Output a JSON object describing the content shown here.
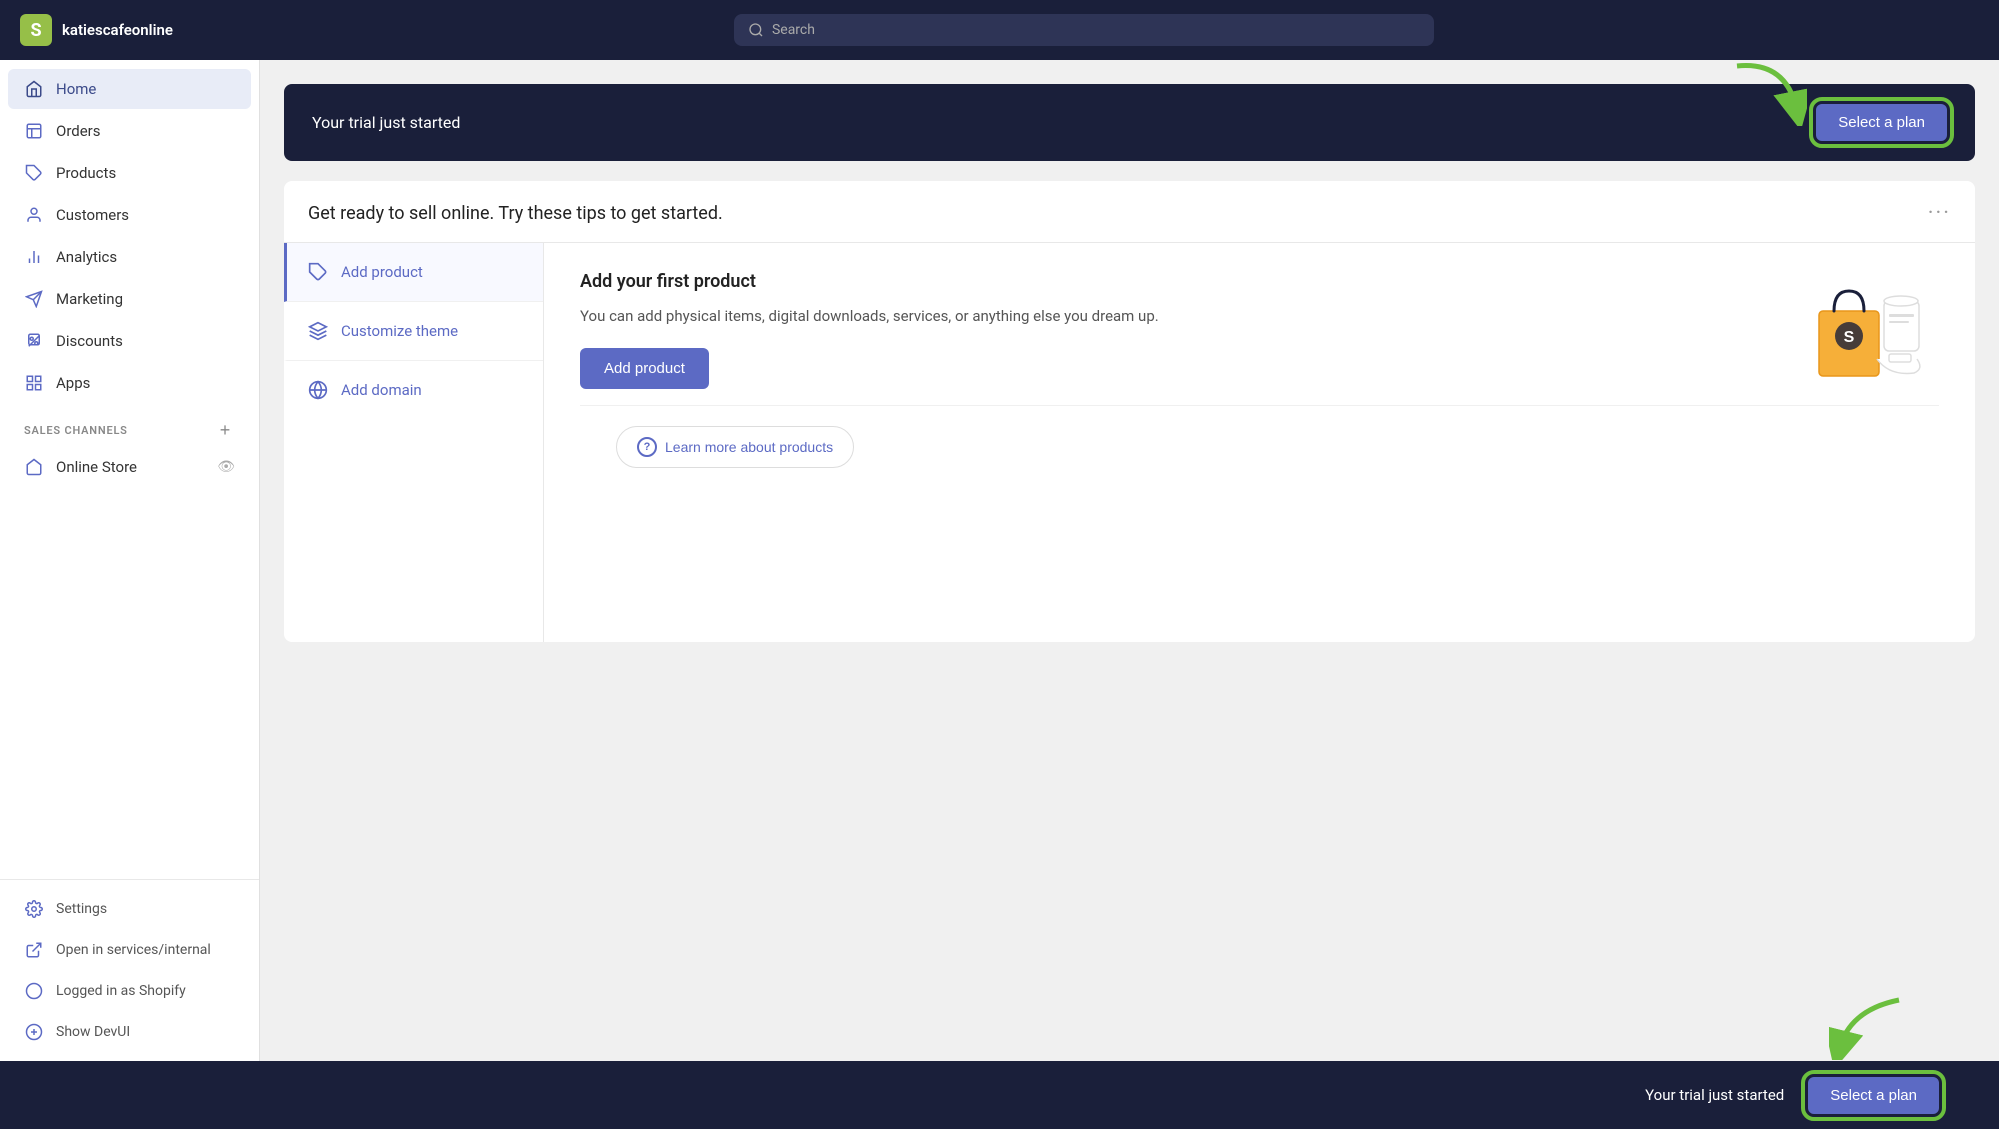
{
  "brand": {
    "name": "katiescafeonline",
    "icon_label": "S"
  },
  "search": {
    "placeholder": "Search"
  },
  "nav": {
    "items": [
      {
        "id": "home",
        "label": "Home",
        "icon": "house",
        "active": true
      },
      {
        "id": "orders",
        "label": "Orders",
        "icon": "receipt"
      },
      {
        "id": "products",
        "label": "Products",
        "icon": "tag"
      },
      {
        "id": "customers",
        "label": "Customers",
        "icon": "person"
      },
      {
        "id": "analytics",
        "label": "Analytics",
        "icon": "bar-chart"
      },
      {
        "id": "marketing",
        "label": "Marketing",
        "icon": "megaphone"
      },
      {
        "id": "discounts",
        "label": "Discounts",
        "icon": "discount"
      },
      {
        "id": "apps",
        "label": "Apps",
        "icon": "grid"
      }
    ],
    "sales_channels_label": "SALES CHANNELS",
    "sales_channels": [
      {
        "id": "online-store",
        "label": "Online Store"
      }
    ],
    "bottom_items": [
      {
        "id": "settings",
        "label": "Settings",
        "icon": "gear"
      },
      {
        "id": "open-internal",
        "label": "Open in services/internal",
        "icon": "external"
      },
      {
        "id": "logged-in",
        "label": "Logged in as Shopify",
        "icon": "circle"
      },
      {
        "id": "show-devui",
        "label": "Show DevUI",
        "icon": "circle"
      }
    ]
  },
  "trial_banner": {
    "text": "Your trial just started",
    "button_label": "Select a plan"
  },
  "tips_card": {
    "title": "Get ready to sell online. Try these tips to get started.",
    "dots_label": "···",
    "items": [
      {
        "id": "add-product",
        "label": "Add product",
        "icon": "tag",
        "active": true
      },
      {
        "id": "customize-theme",
        "label": "Customize theme",
        "icon": "rocket"
      },
      {
        "id": "add-domain",
        "label": "Add domain",
        "icon": "globe"
      }
    ],
    "active_content": {
      "title": "Add your first product",
      "description": "You can add physical items, digital downloads, services, or anything else you dream up.",
      "button_label": "Add product"
    },
    "learn_more": {
      "icon_label": "?",
      "label": "Learn more about products"
    }
  },
  "bottom_bar": {
    "text": "Your trial just started",
    "button_label": "Select a plan"
  }
}
